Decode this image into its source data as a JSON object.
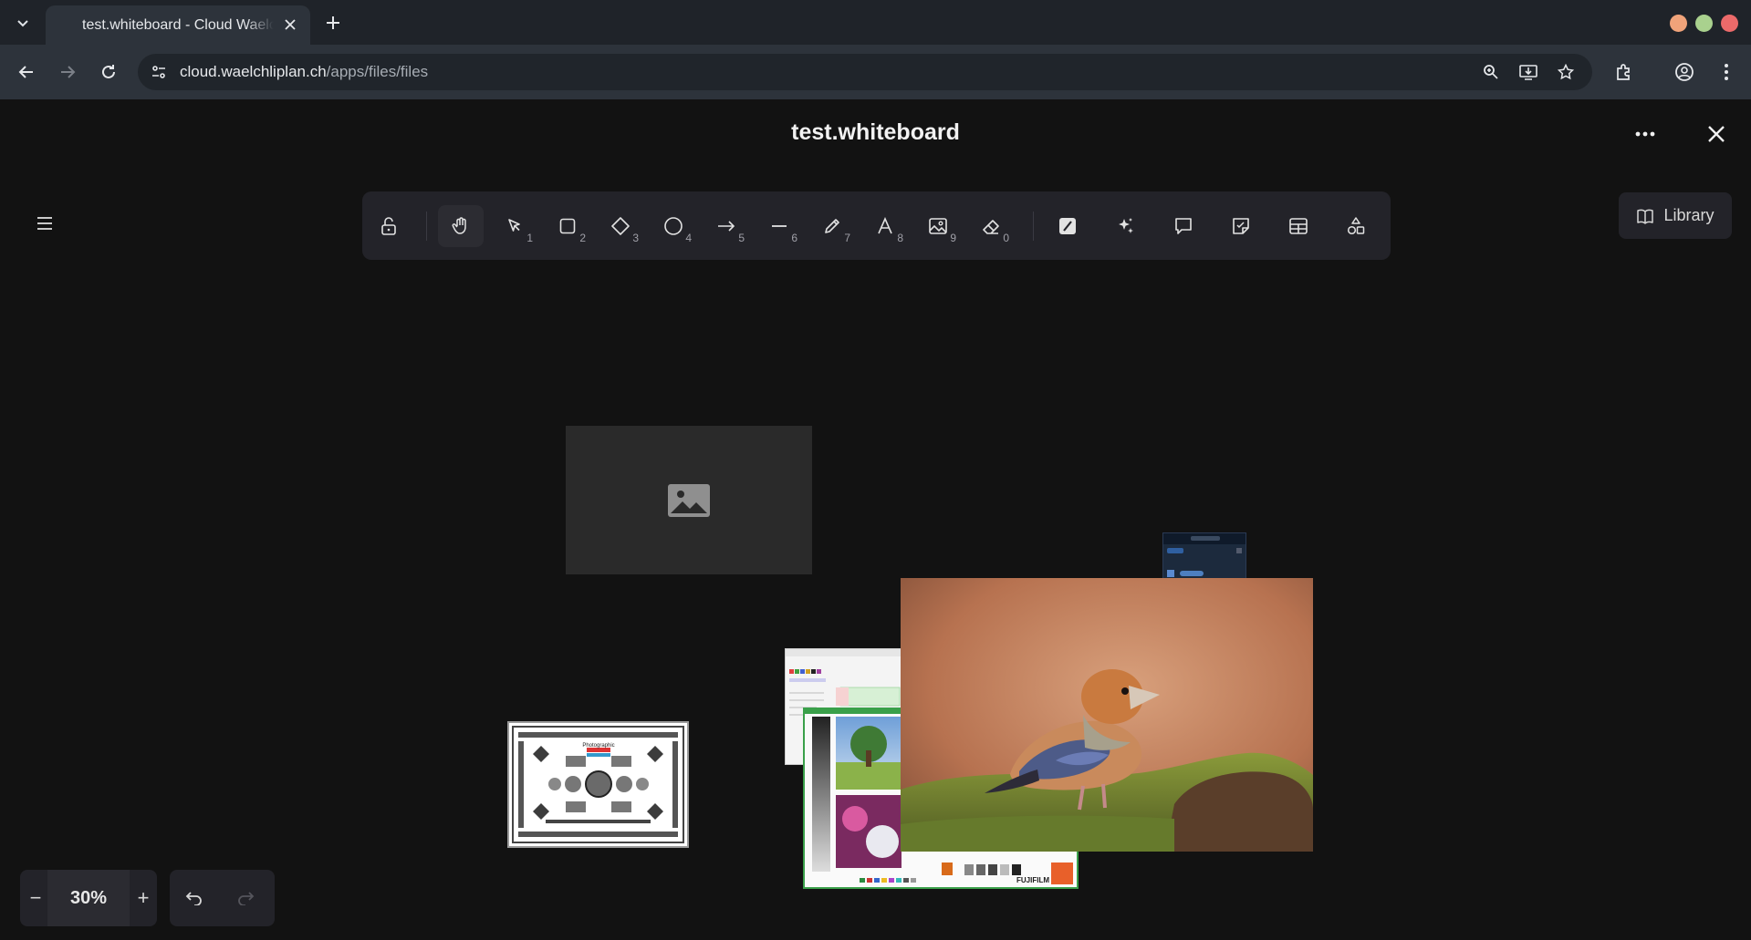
{
  "browser": {
    "tab_title": "test.whiteboard - Cloud Waelchliplan",
    "url_domain": "cloud.waelchliplan.ch",
    "url_path": "/apps/files/files",
    "window_colors": {
      "minimize": "#f0a37a",
      "maximize": "#a9d18e",
      "close": "#ec6a6a"
    }
  },
  "app": {
    "title": "test.whiteboard"
  },
  "toolbar": {
    "tools": [
      {
        "id": "lock",
        "icon": "lock-open-icon",
        "key": ""
      },
      {
        "id": "hand",
        "icon": "hand-icon",
        "key": ""
      },
      {
        "id": "select",
        "icon": "pointer-icon",
        "key": "1"
      },
      {
        "id": "rectangle",
        "icon": "rectangle-icon",
        "key": "2"
      },
      {
        "id": "diamond",
        "icon": "diamond-icon",
        "key": "3"
      },
      {
        "id": "ellipse",
        "icon": "ellipse-icon",
        "key": "4"
      },
      {
        "id": "arrow",
        "icon": "arrow-icon",
        "key": "5"
      },
      {
        "id": "line",
        "icon": "line-icon",
        "key": "6"
      },
      {
        "id": "draw",
        "icon": "pencil-icon",
        "key": "7"
      },
      {
        "id": "text",
        "icon": "text-icon",
        "key": "8"
      },
      {
        "id": "image",
        "icon": "image-icon",
        "key": "9"
      },
      {
        "id": "eraser",
        "icon": "eraser-icon",
        "key": "0"
      },
      {
        "id": "laser",
        "icon": "laser-icon",
        "key": ""
      },
      {
        "id": "ai",
        "icon": "sparkles-icon",
        "key": ""
      },
      {
        "id": "comment",
        "icon": "comment-icon",
        "key": ""
      },
      {
        "id": "sticky",
        "icon": "sticky-note-icon",
        "key": ""
      },
      {
        "id": "table",
        "icon": "table-icon",
        "key": ""
      },
      {
        "id": "shapes",
        "icon": "shapes-icon",
        "key": ""
      }
    ],
    "active_tool": "hand"
  },
  "library": {
    "label": "Library"
  },
  "zoom": {
    "value": "30%",
    "minus": "−",
    "plus": "+"
  },
  "fuji_label": "FUJIFILM",
  "testchart_label": "Photographic"
}
